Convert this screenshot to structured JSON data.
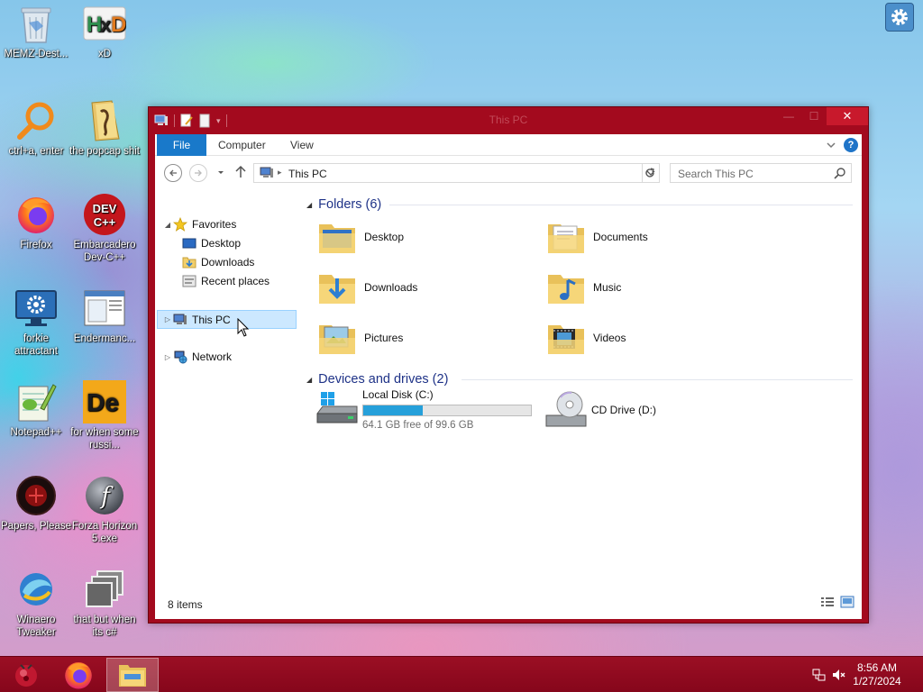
{
  "desktop": {
    "icons": [
      {
        "label": "MEMZ-Dest...",
        "icon": "recycle-bin-icon"
      },
      {
        "label": "xD",
        "icon": "hxd-icon"
      },
      {
        "label": "ctrl+a, enter",
        "icon": "magnifier-icon"
      },
      {
        "label": "the popcap shit",
        "icon": "folder-icon"
      },
      {
        "label": "Firefox",
        "icon": "firefox-icon"
      },
      {
        "label": "Embarcadero Dev-C++",
        "icon": "devcpp-icon"
      },
      {
        "label": "forkie attractant",
        "icon": "monitor-gear-icon"
      },
      {
        "label": "Endermanc...",
        "icon": "window-icon"
      },
      {
        "label": "Notepad++",
        "icon": "notepad-icon"
      },
      {
        "label": "for when some russi...",
        "icon": "de-icon"
      },
      {
        "label": "Papers, Please",
        "icon": "papers-please-icon"
      },
      {
        "label": "Forza Horizon 5.exe",
        "icon": "flash-icon"
      },
      {
        "label": "Winaero Tweaker",
        "icon": "winaero-icon"
      },
      {
        "label": "that but when its c#",
        "icon": "stacked-windows-icon"
      }
    ]
  },
  "window": {
    "title": "This PC",
    "close_glyph": "✕",
    "minimize_glyph": "—",
    "maximize_glyph": "☐"
  },
  "ribbon": {
    "tabs": [
      {
        "label": "File"
      },
      {
        "label": "Computer"
      },
      {
        "label": "View"
      }
    ],
    "help_glyph": "?"
  },
  "address": {
    "path": "This PC",
    "search_placeholder": "Search This PC"
  },
  "nav": {
    "favorites": "Favorites",
    "desktop": "Desktop",
    "downloads": "Downloads",
    "recent": "Recent places",
    "this_pc": "This PC",
    "network": "Network"
  },
  "content": {
    "folders_header": "Folders (6)",
    "folders": [
      {
        "name": "Desktop"
      },
      {
        "name": "Documents"
      },
      {
        "name": "Downloads"
      },
      {
        "name": "Music"
      },
      {
        "name": "Pictures"
      },
      {
        "name": "Videos"
      }
    ],
    "drives_header": "Devices and drives (2)",
    "drives": [
      {
        "name": "Local Disk (C:)",
        "free_text": "64.1 GB free of 99.6 GB",
        "used_fraction": 0.356
      },
      {
        "name": "CD Drive (D:)"
      }
    ]
  },
  "status": {
    "item_count": "8 items"
  },
  "taskbar": {
    "apps": [
      "start-orb-icon",
      "firefox-icon",
      "file-explorer-icon"
    ],
    "time": "8:56 AM",
    "date": "1/27/2024"
  },
  "colors": {
    "window_frame": "#a30a1e",
    "accent_blue": "#1979ca",
    "group_header": "#1e3287",
    "progress_fill": "#26a0da",
    "taskbar": "#8e0a1f"
  }
}
